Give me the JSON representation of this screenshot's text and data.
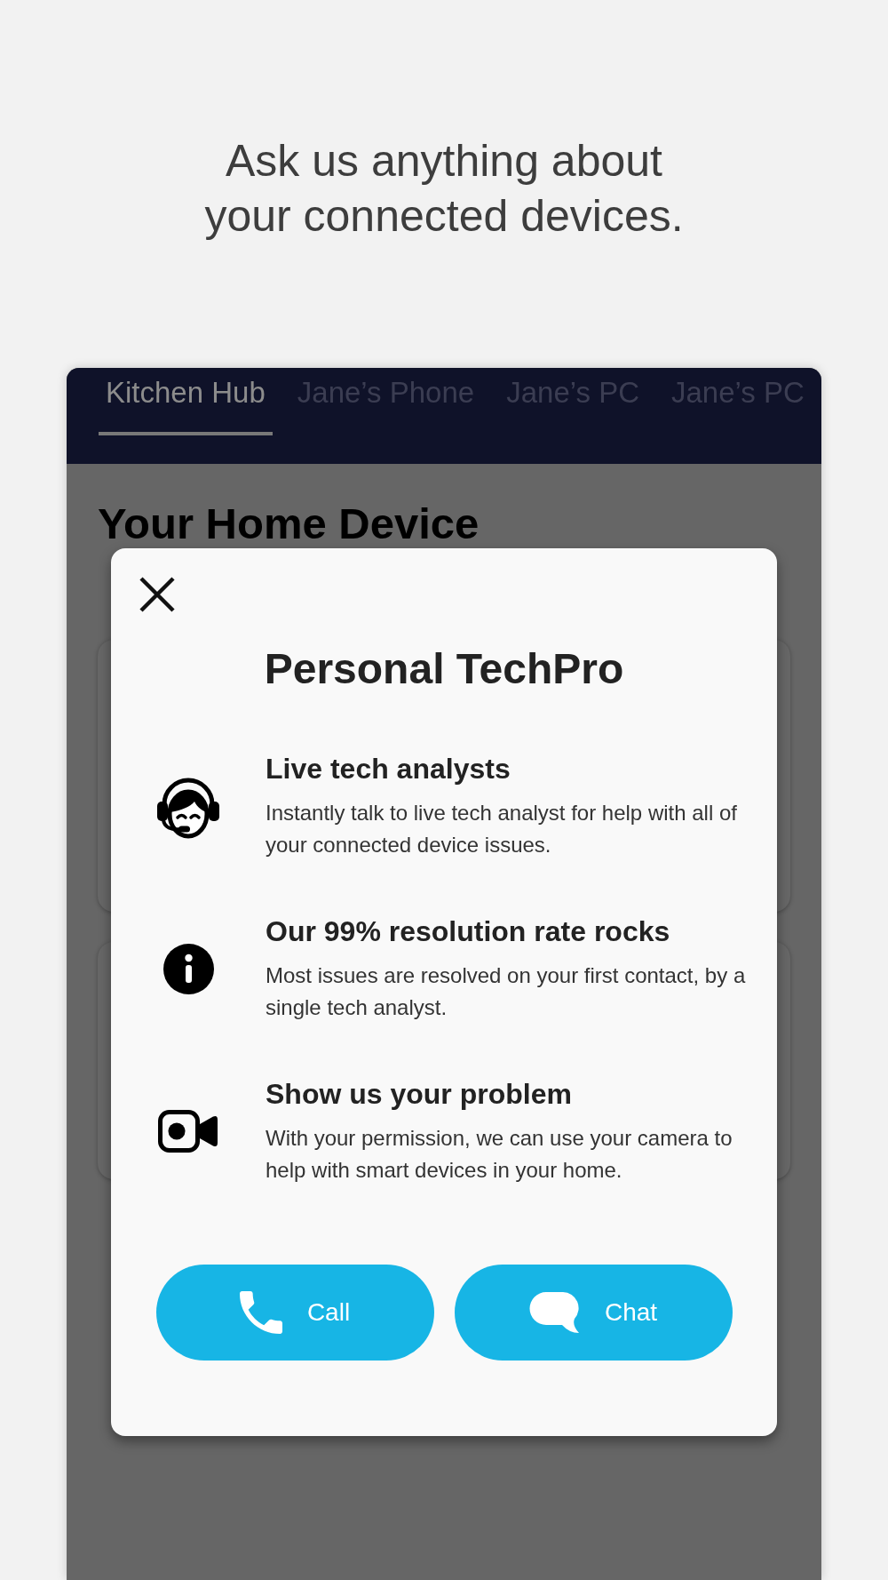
{
  "headline": {
    "text": "Ask us anything about your connected devices."
  },
  "device_tabs": [
    {
      "label": "Kitchen Hub",
      "selected": true
    },
    {
      "label": "Jane’s Phone",
      "selected": false
    },
    {
      "label": "Jane’s PC",
      "selected": false
    },
    {
      "label": "Jane’s PC",
      "selected": false
    }
  ],
  "home": {
    "title": "Your Home Device"
  },
  "dialog": {
    "title": "Personal TechPro",
    "features": [
      {
        "title": "Live tech analysts",
        "description": "Instantly talk to live tech analyst for help with all of your connected device issues."
      },
      {
        "title": "Our 99% resolution rate rocks",
        "description": "Most issues are resolved on your first contact, by a single tech analyst."
      },
      {
        "title": "Show us your problem",
        "description": "With your permission, we can use your camera to help with smart devices in your home."
      }
    ],
    "buttons": [
      {
        "label": "Call"
      },
      {
        "label": "Chat"
      }
    ]
  }
}
